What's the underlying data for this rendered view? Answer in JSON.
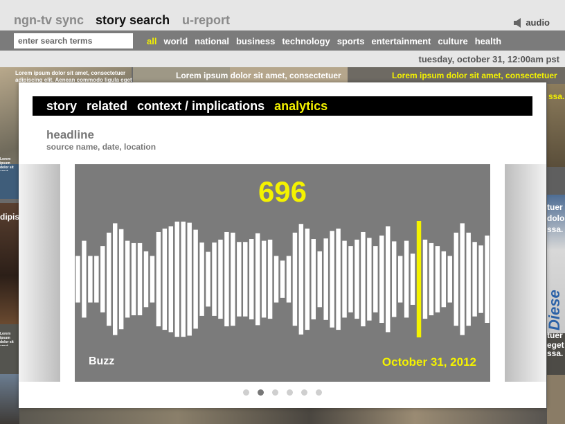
{
  "header": {
    "tabs": [
      {
        "label": "ngn-tv sync",
        "active": false
      },
      {
        "label": "story search",
        "active": true
      },
      {
        "label": "u-report",
        "active": false
      }
    ],
    "audio_label": "audio"
  },
  "nav": {
    "search_placeholder": "enter search terms",
    "categories": [
      "all",
      "world",
      "national",
      "business",
      "technology",
      "sports",
      "entertainment",
      "culture",
      "health"
    ],
    "active_category": "all"
  },
  "datetime": "tuesday, october 31, 12:00am pst",
  "background": {
    "snippets": [
      "Lorem ipsum dolor sit amet, consectetuer adipiscing elit. Aenean commodo ligula eget",
      "Lorem ipsum dolor sit amet, consectetuer",
      "Lorem ipsum dolor sit amet, consectetuer",
      "ssa.",
      "dipis",
      "tuer",
      "dolor",
      "ssa.",
      "Diese",
      "tuer",
      "eget",
      "ssa.",
      "Lorem ipsum dolor sit amet, consectetuer adipiscing elit.",
      "Lorem ipsum dolor sit amet, consectetuer adipiscing elit."
    ]
  },
  "modal": {
    "tabs": [
      {
        "label": "story",
        "active": false
      },
      {
        "label": "related",
        "active": false
      },
      {
        "label": "context / implications",
        "active": false
      },
      {
        "label": "analytics",
        "active": true
      }
    ],
    "headline": "headline",
    "source": "source name, date, location",
    "analytics": {
      "count": "696",
      "label": "Buzz",
      "date": "October 31, 2012",
      "colors": {
        "bars": "#ffffff",
        "highlight": "#f4f200",
        "background": "#7b7b7b"
      }
    },
    "pagination": {
      "count": 6,
      "active_index": 1
    }
  },
  "chart_data": {
    "type": "bar",
    "series": [
      {
        "values": [
          0.4,
          0.66,
          0.4,
          0.4,
          0.57,
          0.8,
          0.96,
          0.86,
          0.66,
          0.62,
          0.62,
          0.48,
          0.4,
          0.81,
          0.87,
          0.91,
          0.99,
          0.99,
          0.97,
          0.85,
          0.63,
          0.47,
          0.63,
          0.68,
          0.81,
          0.8,
          0.64,
          0.64,
          0.69,
          0.79,
          0.66,
          0.68,
          0.4,
          0.32,
          0.4,
          0.8,
          0.95,
          0.87,
          0.69,
          0.48,
          0.7,
          0.83,
          0.87,
          0.66,
          0.57,
          0.68,
          0.81,
          0.71,
          0.57,
          0.75,
          0.91,
          0.65,
          0.4,
          0.66,
          0.44,
          1.0,
          0.68,
          0.62,
          0.57,
          0.48,
          0.4,
          0.8,
          0.96,
          0.8,
          0.64,
          0.58,
          0.75
        ]
      }
    ],
    "highlight_index": 55,
    "ylim": [
      0,
      1
    ]
  }
}
